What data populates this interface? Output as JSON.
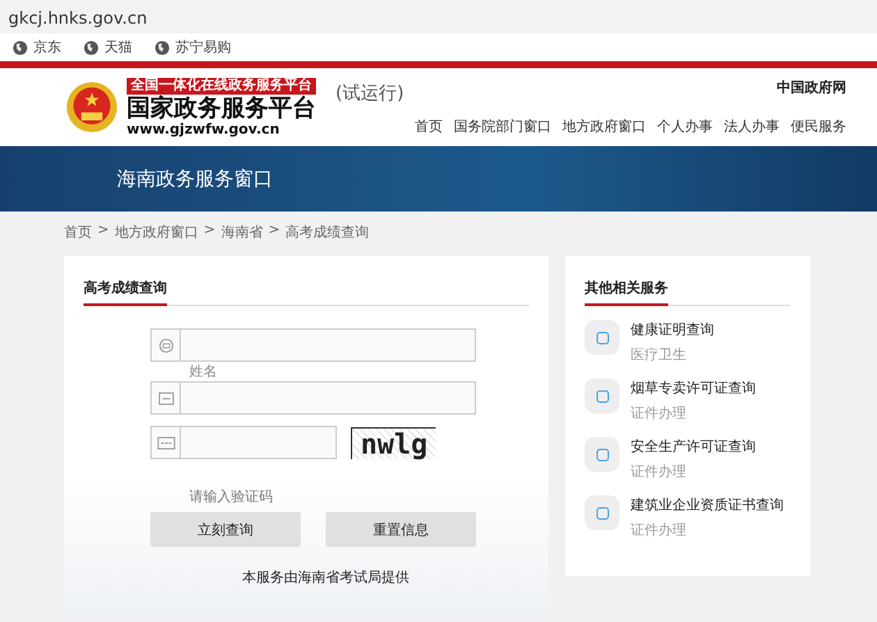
{
  "browser": {
    "url": "gkcj.hnks.gov.cn",
    "bookmarks": [
      "京东",
      "天猫",
      "苏宁易购"
    ]
  },
  "header": {
    "slogan": "全国一体化在线政务服务平台",
    "title": "国家政务服务平台",
    "site": "www.gjzwfw.gov.cn",
    "trial": "(试运行)",
    "top_link": "中国政府网",
    "nav": [
      "首页",
      "国务院部门窗口",
      "地方政府窗口",
      "个人办事",
      "法人办事",
      "便民服务"
    ]
  },
  "banner": {
    "title": "海南政务服务窗口"
  },
  "breadcrumb": {
    "separator": ">",
    "items": [
      "首页",
      "地方政府窗口",
      "海南省",
      "高考成绩查询"
    ]
  },
  "query": {
    "title": "高考成绩查询",
    "name_label": "姓名",
    "captcha_text": "nwlg",
    "captcha_hint": "请输入验证码",
    "buttons": [
      "立刻查询",
      "重置信息"
    ],
    "footer": "本服务由海南省考试局提供"
  },
  "related": {
    "title": "其他相关服务",
    "items": [
      {
        "name": "健康证明查询",
        "category": "医疗卫生"
      },
      {
        "name": "烟草专卖许可证查询",
        "category": "证件办理"
      },
      {
        "name": "安全生产许可证查询",
        "category": "证件办理"
      },
      {
        "name": "建筑业企业资质证书查询",
        "category": "证件办理"
      }
    ]
  }
}
